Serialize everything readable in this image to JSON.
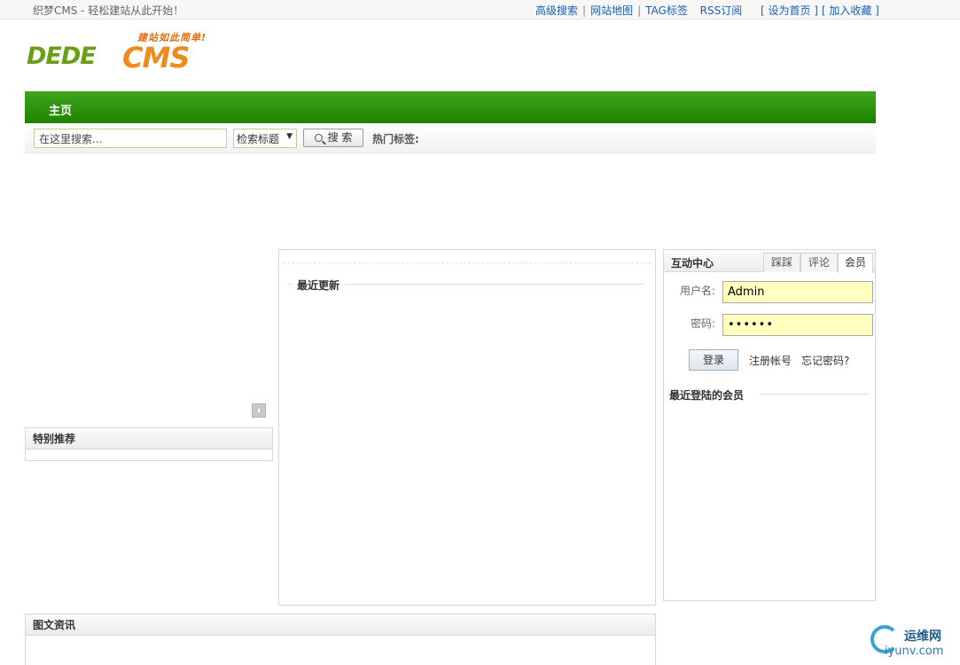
{
  "topbar": {
    "welcome": "织梦CMS - 轻松建站从此开始！",
    "links": [
      "高级搜索",
      "网站地图",
      "TAG标签",
      "RSS订阅"
    ],
    "set_home": "[ 设为首页 ]",
    "add_fav": "[ 加入收藏 ]"
  },
  "logo": {
    "slogan": "建站如此简单!",
    "dede": "DEDE",
    "cms": "CMS"
  },
  "nav": {
    "home": "主页"
  },
  "search": {
    "placeholder": "在这里搜索...",
    "select_value": "检索标题",
    "button_label": "搜 索",
    "hot_tags_label": "热门标签:"
  },
  "left": {
    "special_title": "特别推荐"
  },
  "center": {
    "latest_title": "最近更新"
  },
  "right": {
    "title": "互动中心",
    "tabs": [
      "踩踩",
      "评论",
      "会员"
    ],
    "username_label": "用户名:",
    "username_value": "Admin",
    "password_label": "密码:",
    "password_value": "••••••",
    "login_label": "登录",
    "register_label": "注册帐号",
    "forgot_label": "忘记密码?",
    "recent_members_title": "最近登陆的会员"
  },
  "bottom": {
    "pic_news_title": "图文资讯"
  },
  "watermark": {
    "cn": "运维网",
    "en": "iyunv.com"
  },
  "colors": {
    "nav_green": "#1f8200",
    "input_highlight": "#ffffc0",
    "link_blue": "#1a5fb4"
  }
}
